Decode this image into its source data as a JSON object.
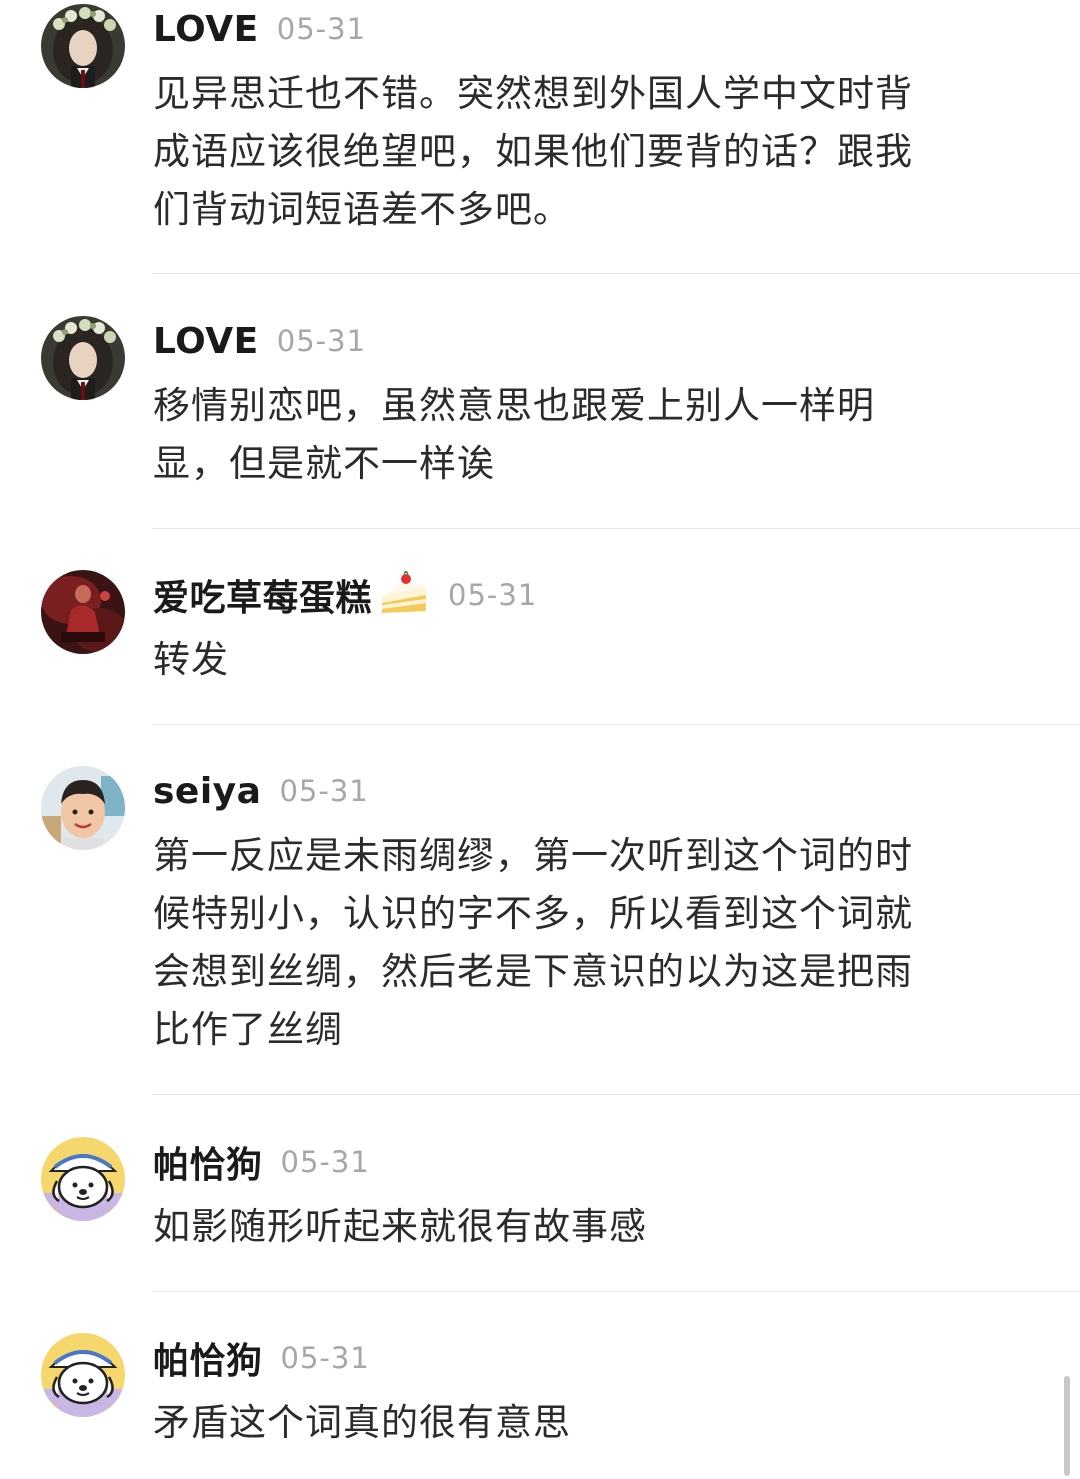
{
  "comments": [
    {
      "username": "LOVE",
      "time": "05-31",
      "text": "见异思迁也不错。突然想到外国人学中文时背\n成语应该很绝望吧，如果他们要背的话？跟我\n们背动词短语差不多吧。",
      "avatar_icon": "flower-crown-portrait-avatar"
    },
    {
      "username": "LOVE",
      "time": "05-31",
      "text": "移情别恋吧，虽然意思也跟爱上别人一样明\n显，但是就不一样诶",
      "avatar_icon": "flower-crown-portrait-avatar"
    },
    {
      "username": "爱吃草莓蛋糕",
      "username_emoji": "strawberry-cake-icon",
      "time": "05-31",
      "text": "转发",
      "avatar_icon": "red-stage-photo-avatar"
    },
    {
      "username": "seiya",
      "time": "05-31",
      "text": "第一反应是未雨绸缪，第一次听到这个词的时\n候特别小，认识的字不多，所以看到这个词就\n会想到丝绸，然后老是下意识的以为这是把雨\n比作了丝绸",
      "avatar_icon": "child-photo-avatar"
    },
    {
      "username": "帕恰狗",
      "time": "05-31",
      "text": "如影随形听起来就很有故事感",
      "avatar_icon": "cartoon-dog-avatar"
    },
    {
      "username": "帕恰狗",
      "time": "05-31",
      "text": "矛盾这个词真的很有意思",
      "avatar_icon": "cartoon-dog-avatar"
    }
  ],
  "colors": {
    "background": "#ffffff",
    "username": "#1a1a1a",
    "timestamp": "#a7a7a7",
    "comment_text": "#2b2b2b",
    "divider": "#e8e8e8"
  }
}
